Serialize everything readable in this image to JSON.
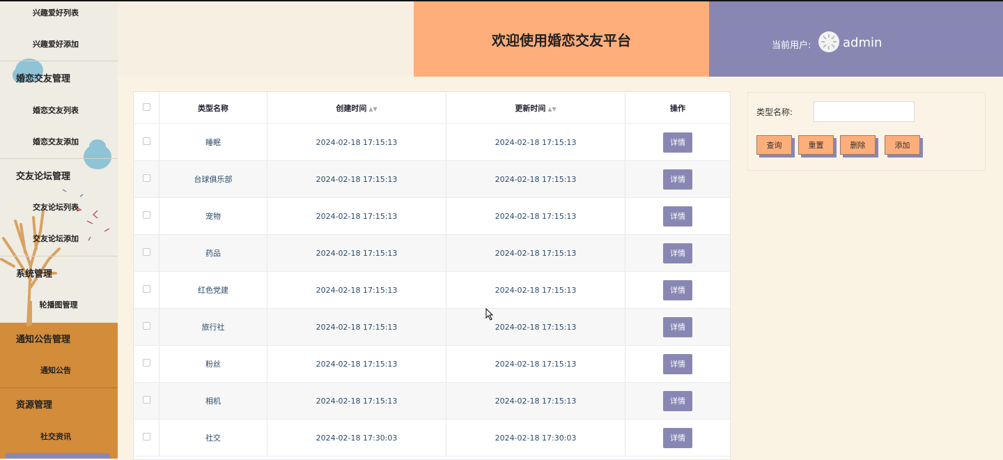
{
  "sidebar": {
    "items": [
      {
        "label": "兴趣爱好列表",
        "type": "sub"
      },
      {
        "label": "兴趣爱好添加",
        "type": "sub"
      },
      {
        "label": "婚恋交友管理",
        "type": "head"
      },
      {
        "label": "婚恋交友列表",
        "type": "sub"
      },
      {
        "label": "婚恋交友添加",
        "type": "sub"
      },
      {
        "label": "交友论坛管理",
        "type": "head"
      },
      {
        "label": "交友论坛列表",
        "type": "sub"
      },
      {
        "label": "交友论坛添加",
        "type": "sub"
      },
      {
        "label": "系统管理",
        "type": "head"
      },
      {
        "label": "轮播图管理",
        "type": "sub"
      },
      {
        "label": "通知公告管理",
        "type": "head"
      },
      {
        "label": "通知公告",
        "type": "sub"
      },
      {
        "label": "资源管理",
        "type": "head"
      },
      {
        "label": "社交资讯",
        "type": "sub"
      }
    ]
  },
  "header": {
    "title": "欢迎使用婚恋交友平台",
    "user_label": "当前用户:",
    "user_name": "admin"
  },
  "table": {
    "columns": [
      "类型名称",
      "创建时间",
      "更新时间",
      "操作"
    ],
    "rows": [
      {
        "name": "睡眠",
        "created": "2024-02-18 17:15:13",
        "updated": "2024-02-18 17:15:13",
        "action": "详情"
      },
      {
        "name": "台球俱乐部",
        "created": "2024-02-18 17:15:13",
        "updated": "2024-02-18 17:15:13",
        "action": "详情"
      },
      {
        "name": "宠物",
        "created": "2024-02-18 17:15:13",
        "updated": "2024-02-18 17:15:13",
        "action": "详情"
      },
      {
        "name": "药品",
        "created": "2024-02-18 17:15:13",
        "updated": "2024-02-18 17:15:13",
        "action": "详情"
      },
      {
        "name": "红色党建",
        "created": "2024-02-18 17:15:13",
        "updated": "2024-02-18 17:15:13",
        "action": "详情"
      },
      {
        "name": "旅行社",
        "created": "2024-02-18 17:15:13",
        "updated": "2024-02-18 17:15:13",
        "action": "详情"
      },
      {
        "name": "粉丝",
        "created": "2024-02-18 17:15:13",
        "updated": "2024-02-18 17:15:13",
        "action": "详情"
      },
      {
        "name": "相机",
        "created": "2024-02-18 17:15:13",
        "updated": "2024-02-18 17:15:13",
        "action": "详情"
      },
      {
        "name": "社交",
        "created": "2024-02-18 17:30:03",
        "updated": "2024-02-18 17:30:03",
        "action": "详情"
      }
    ]
  },
  "search": {
    "label": "类型名称:",
    "value": "",
    "buttons": [
      "查询",
      "重置",
      "删除",
      "添加"
    ]
  },
  "colors": {
    "accent_orange": "#feae7b",
    "accent_purple": "#8887b4",
    "sidebar_orange": "#d38c3a"
  }
}
